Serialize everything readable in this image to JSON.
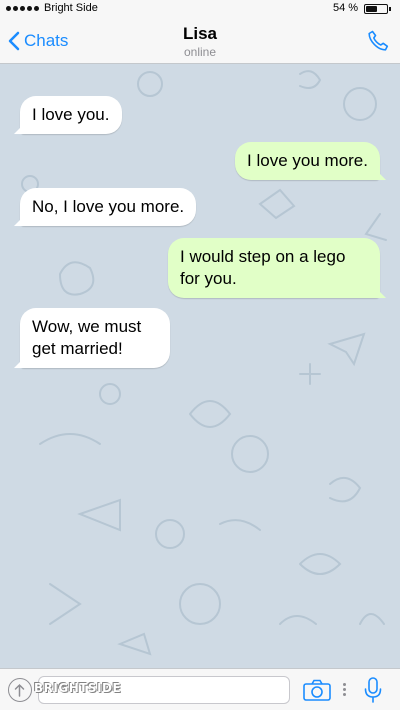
{
  "status_bar": {
    "carrier": "Bright Side",
    "battery_text": "54 %",
    "battery_level": 0.54
  },
  "header": {
    "back_label": "Chats",
    "contact_name": "Lisa",
    "contact_status": "online"
  },
  "messages": [
    {
      "direction": "incoming",
      "text": "I love you."
    },
    {
      "direction": "outgoing",
      "text": "I love you more."
    },
    {
      "direction": "incoming",
      "text": "No, I love you more."
    },
    {
      "direction": "outgoing",
      "text": "I would step on a lego\nfor you."
    },
    {
      "direction": "incoming",
      "text": "Wow, we must\nget married!"
    }
  ],
  "input_bar": {
    "placeholder": "",
    "watermark": "BRIGHTSIDE"
  },
  "colors": {
    "accent": "#1a8cff",
    "incoming_bubble": "#ffffff",
    "outgoing_bubble": "#e1ffc7",
    "wallpaper": "#cfdae4"
  },
  "icons": [
    "back-chevron-icon",
    "phone-icon",
    "attach-icon",
    "camera-icon",
    "microphone-icon"
  ]
}
